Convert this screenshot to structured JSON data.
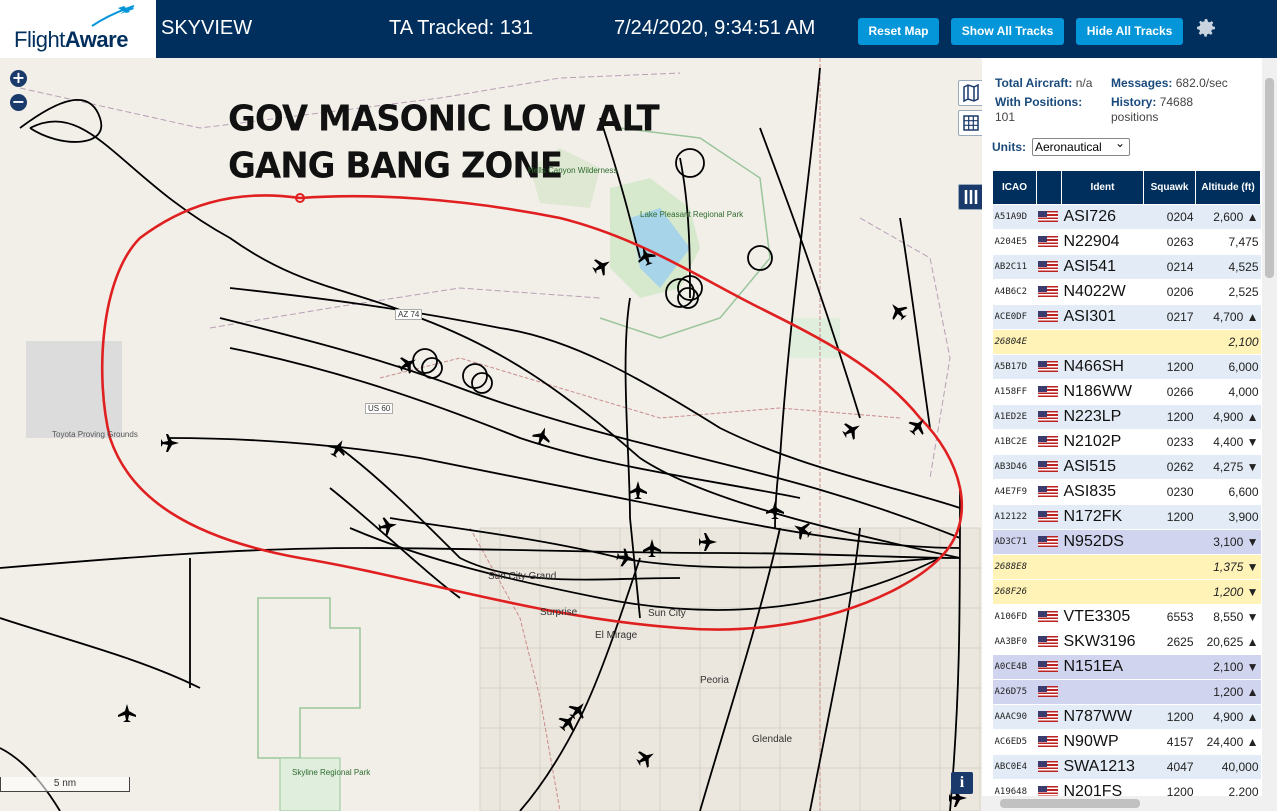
{
  "header": {
    "logo_text_light": "Flight",
    "logo_text_bold": "Aware",
    "app_name": "SKYVIEW",
    "tracked": "TA Tracked: 131",
    "datetime": "7/24/2020, 9:34:51 AM",
    "buttons": {
      "reset": "Reset Map",
      "show": "Show All Tracks",
      "hide": "Hide All Tracks"
    },
    "gear_icon": "gear-icon",
    "colors": {
      "bar": "#002f5d",
      "button": "#0596d9"
    }
  },
  "map": {
    "zoom_in": "+",
    "zoom_out": "−",
    "annotation_line1": "GOV MASONIC LOW ALT",
    "annotation_line2": "GANG BANG ZONE",
    "annotation_color": "#e02020",
    "places": {
      "toyota": "Toyota Proving Grounds",
      "sun_city_grand": "Sun City Grand",
      "surprise": "Surprise",
      "sun_city": "Sun City",
      "el_mirage": "El Mirage",
      "peoria": "Peoria",
      "glendale": "Glendale",
      "skyline": "Skyline Regional Park",
      "lake_pleasant": "Lake Pleasant Regional Park",
      "hells_canyon": "Hells Canyon Wilderness",
      "az74": "AZ 74",
      "us60": "US 60"
    },
    "scale": "5 nm",
    "info": "i"
  },
  "panel": {
    "total_label": "Total Aircraft:",
    "total_value": "n/a",
    "messages_label": "Messages:",
    "messages_value": "682.0/sec",
    "positions_label": "With Positions:",
    "positions_value": "101",
    "history_label": "History:",
    "history_value": "74688",
    "history_unit": "positions",
    "units_label": "Units:",
    "units_value": "Aeronautical",
    "columns": [
      "ICAO",
      "",
      "Ident",
      "Squawk",
      "Altitude (ft)"
    ],
    "rows": [
      {
        "icao": "A51A9D",
        "flag": true,
        "ident": "ASI726",
        "squawk": "0204",
        "alt": "2,600 ▲",
        "style": "rb"
      },
      {
        "icao": "A204E5",
        "flag": true,
        "ident": "N22904",
        "squawk": "0263",
        "alt": "7,475",
        "style": "rw"
      },
      {
        "icao": "AB2C11",
        "flag": true,
        "ident": "ASI541",
        "squawk": "0214",
        "alt": "4,525",
        "style": "rb"
      },
      {
        "icao": "A4B6C2",
        "flag": true,
        "ident": "N4022W",
        "squawk": "0206",
        "alt": "2,525",
        "style": "rw"
      },
      {
        "icao": "ACE0DF",
        "flag": true,
        "ident": "ASI301",
        "squawk": "0217",
        "alt": "4,700 ▲",
        "style": "rb"
      },
      {
        "icao": "26804E",
        "flag": false,
        "ident": "",
        "squawk": "",
        "alt": "2,100",
        "style": "ry"
      },
      {
        "icao": "A5B17D",
        "flag": true,
        "ident": "N466SH",
        "squawk": "1200",
        "alt": "6,000",
        "style": "rb"
      },
      {
        "icao": "A158FF",
        "flag": true,
        "ident": "N186WW",
        "squawk": "0266",
        "alt": "4,000",
        "style": "rw"
      },
      {
        "icao": "A1ED2E",
        "flag": true,
        "ident": "N223LP",
        "squawk": "1200",
        "alt": "4,900 ▲",
        "style": "rb"
      },
      {
        "icao": "A1BC2E",
        "flag": true,
        "ident": "N2102P",
        "squawk": "0233",
        "alt": "4,400 ▼",
        "style": "rw"
      },
      {
        "icao": "AB3D46",
        "flag": true,
        "ident": "ASI515",
        "squawk": "0262",
        "alt": "4,275 ▼",
        "style": "rb"
      },
      {
        "icao": "A4E7F9",
        "flag": true,
        "ident": "ASI835",
        "squawk": "0230",
        "alt": "6,600",
        "style": "rw"
      },
      {
        "icao": "A12122",
        "flag": true,
        "ident": "N172FK",
        "squawk": "1200",
        "alt": "3,900",
        "style": "rb"
      },
      {
        "icao": "AD3C71",
        "flag": true,
        "ident": "N952DS",
        "squawk": "",
        "alt": "3,100 ▼",
        "style": "rp"
      },
      {
        "icao": "2688E8",
        "flag": false,
        "ident": "",
        "squawk": "",
        "alt": "1,375 ▼",
        "style": "ry"
      },
      {
        "icao": "268F26",
        "flag": false,
        "ident": "",
        "squawk": "",
        "alt": "1,200 ▼",
        "style": "ry"
      },
      {
        "icao": "A106FD",
        "flag": true,
        "ident": "VTE3305",
        "squawk": "6553",
        "alt": "8,550 ▼",
        "style": "rw"
      },
      {
        "icao": "AA3BF0",
        "flag": true,
        "ident": "SKW3196",
        "squawk": "2625",
        "alt": "20,625 ▲",
        "style": "rw"
      },
      {
        "icao": "A0CE4B",
        "flag": true,
        "ident": "N151EA",
        "squawk": "",
        "alt": "2,100 ▼",
        "style": "rp"
      },
      {
        "icao": "A26D75",
        "flag": true,
        "ident": "",
        "squawk": "",
        "alt": "1,200 ▲",
        "style": "rp"
      },
      {
        "icao": "AAAC90",
        "flag": true,
        "ident": "N787WW",
        "squawk": "1200",
        "alt": "4,900 ▲",
        "style": "rb"
      },
      {
        "icao": "AC6ED5",
        "flag": true,
        "ident": "N90WP",
        "squawk": "4157",
        "alt": "24,400 ▲",
        "style": "rw"
      },
      {
        "icao": "ABC0E4",
        "flag": true,
        "ident": "SWA1213",
        "squawk": "4047",
        "alt": "40,000",
        "style": "rb"
      },
      {
        "icao": "A19648",
        "flag": true,
        "ident": "N201FS",
        "squawk": "1200",
        "alt": "2,200",
        "style": "rw"
      }
    ]
  }
}
